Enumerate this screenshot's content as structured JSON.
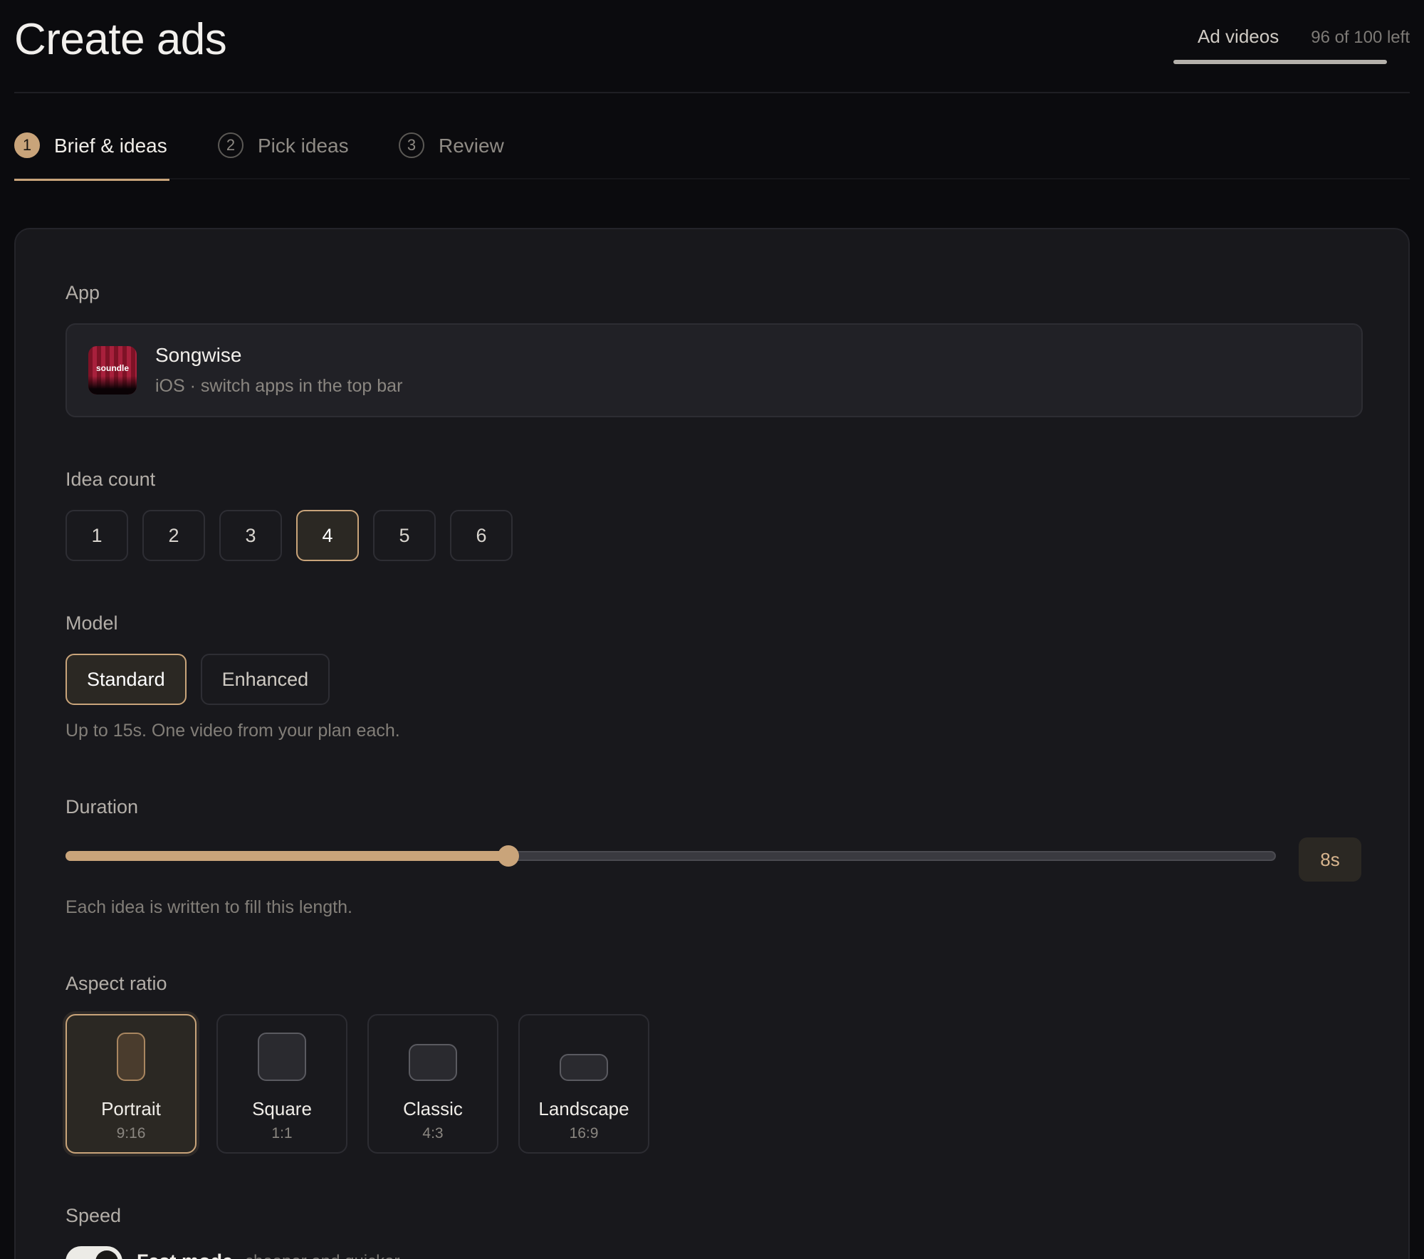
{
  "header": {
    "title": "Create ads",
    "usage_label": "Ad videos",
    "usage_count": "96 of 100 left",
    "usage_progress": 0.96
  },
  "steps": [
    {
      "num": "1",
      "label": "Brief & ideas",
      "active": true
    },
    {
      "num": "2",
      "label": "Pick ideas",
      "active": false
    },
    {
      "num": "3",
      "label": "Review",
      "active": false
    }
  ],
  "app_section": {
    "label": "App",
    "app_name": "Songwise",
    "app_sub": "iOS · switch apps in the top bar",
    "icon_text": "soundle"
  },
  "idea_count": {
    "label": "Idea count",
    "options": [
      "1",
      "2",
      "3",
      "4",
      "5",
      "6"
    ],
    "selected": "4"
  },
  "model": {
    "label": "Model",
    "options": [
      "Standard",
      "Enhanced"
    ],
    "selected": "Standard",
    "hint": "Up to 15s. One video from your plan each."
  },
  "duration": {
    "label": "Duration",
    "value_label": "8s",
    "fraction": 0.366,
    "hint": "Each idea is written to fill this length."
  },
  "aspect_ratio": {
    "label": "Aspect ratio",
    "options": [
      {
        "name": "Portrait",
        "ratio": "9:16",
        "selected": true
      },
      {
        "name": "Square",
        "ratio": "1:1",
        "selected": false
      },
      {
        "name": "Classic",
        "ratio": "4:3",
        "selected": false
      },
      {
        "name": "Landscape",
        "ratio": "16:9",
        "selected": false
      }
    ]
  },
  "speed": {
    "label": "Speed",
    "toggle_label": "Fast mode",
    "toggle_sub": "cheaper and quicker",
    "enabled": true
  },
  "colors": {
    "accent": "#c9a47a",
    "background": "#0b0b0e",
    "card": "#18181c"
  }
}
